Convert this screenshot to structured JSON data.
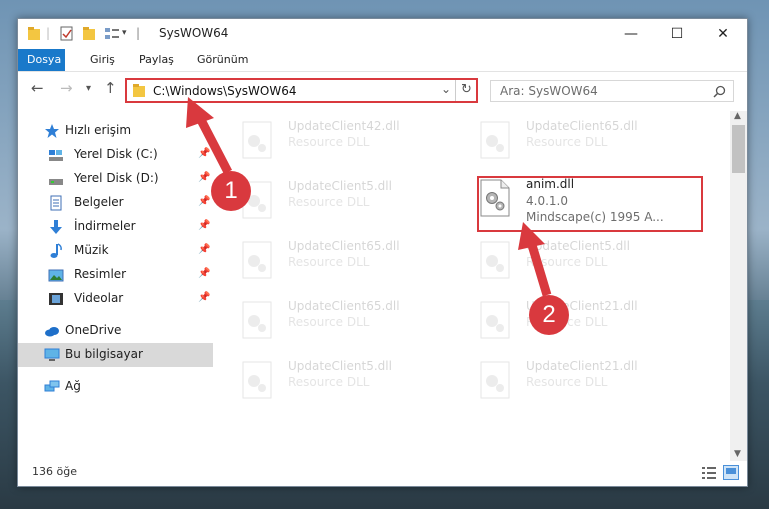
{
  "titlebar": {
    "title": "SysWOW64",
    "minimize": "—",
    "maximize": "☐",
    "close": "✕"
  },
  "ribbon": {
    "tabs": [
      "Dosya",
      "Giriş",
      "Paylaş",
      "Görünüm"
    ],
    "active_tab": "Dosya"
  },
  "address": {
    "path": "C:\\Windows\\SysWOW64",
    "dropdown": "⌄",
    "refresh": "↻"
  },
  "search": {
    "placeholder": "Ara: SysWOW64",
    "icon": "search-icon"
  },
  "sidebar": {
    "items": [
      {
        "label": "Hızlı erişim",
        "icon": "star-icon",
        "pinned": false
      },
      {
        "label": "Yerel Disk (C:)",
        "icon": "drive-icon",
        "pinned": true
      },
      {
        "label": "Yerel Disk (D:)",
        "icon": "drive-icon",
        "pinned": true
      },
      {
        "label": "Belgeler",
        "icon": "documents-icon",
        "pinned": true
      },
      {
        "label": "İndirmeler",
        "icon": "download-icon",
        "pinned": true
      },
      {
        "label": "Müzik",
        "icon": "music-icon",
        "pinned": true
      },
      {
        "label": "Resimler",
        "icon": "pictures-icon",
        "pinned": true
      },
      {
        "label": "Videolar",
        "icon": "videos-icon",
        "pinned": true
      },
      {
        "label": "OneDrive",
        "icon": "cloud-icon",
        "pinned": false
      },
      {
        "label": "Bu bilgisayar",
        "icon": "computer-icon",
        "pinned": false,
        "selected": true
      },
      {
        "label": "Ağ",
        "icon": "network-icon",
        "pinned": false
      }
    ]
  },
  "files": [
    {
      "name": "UpdateClient42.dll",
      "type": "Resource DLL",
      "faded": true
    },
    {
      "name": "UpdateClient65.dll",
      "type": "Resource DLL",
      "faded": true
    },
    {
      "name": "UpdateClient5.dll",
      "type": "Resource DLL",
      "faded": true
    },
    {
      "name": "anim.dll",
      "version": "4.0.1.0",
      "company": "Mindscape(c) 1995 A...",
      "faded": false,
      "highlighted": true
    },
    {
      "name": "UpdateClient65.dll",
      "type": "Resource DLL",
      "faded": true
    },
    {
      "name": "UpdateClient5.dll",
      "type": "Resource DLL",
      "faded": true
    },
    {
      "name": "UpdateClient65.dll",
      "type": "Resource DLL",
      "faded": true
    },
    {
      "name": "UpdateClient21.dll",
      "type": "Resource DLL",
      "faded": true
    },
    {
      "name": "UpdateClient5.dll",
      "type": "Resource DLL",
      "faded": true
    },
    {
      "name": "UpdateClient21.dll",
      "type": "Resource DLL",
      "faded": true
    }
  ],
  "status": {
    "count": "136 öğe"
  },
  "annotations": {
    "step1": "1",
    "step2": "2",
    "color": "#d9393e"
  },
  "colors": {
    "accent": "#1979ca",
    "highlight": "#d9393e",
    "selected_bg": "#d9d9d9"
  }
}
